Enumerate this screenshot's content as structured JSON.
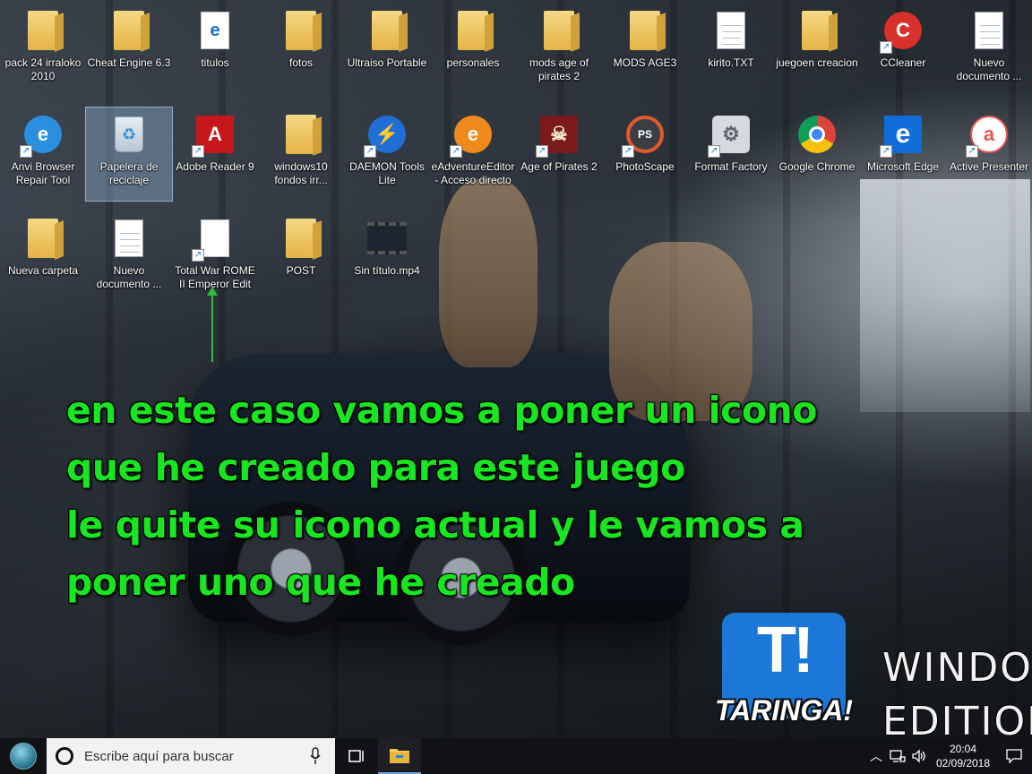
{
  "desktop": {
    "icons": [
      {
        "label": "pack 24  irraloko 2010",
        "icon": "folder-zip-icon"
      },
      {
        "label": "Cheat Engine 6.3",
        "icon": "folder-icon"
      },
      {
        "label": "titulos",
        "icon": "ie-file-icon"
      },
      {
        "label": "fotos",
        "icon": "folder-icon"
      },
      {
        "label": "Ultraiso Portable",
        "icon": "folder-icon"
      },
      {
        "label": "personales",
        "icon": "folder-icon"
      },
      {
        "label": "mods age of pirates 2",
        "icon": "folder-icon"
      },
      {
        "label": "MODS AGE3",
        "icon": "folder-icon"
      },
      {
        "label": "kirito.TXT",
        "icon": "text-file-icon"
      },
      {
        "label": "juegoen creacion",
        "icon": "folder-icon"
      },
      {
        "label": "CCleaner",
        "icon": "ccleaner-icon"
      },
      {
        "label": "Nuevo documento ...",
        "icon": "text-file-icon"
      },
      {
        "label": "Anvi Browser Repair Tool",
        "icon": "internet-explorer-icon"
      },
      {
        "label": "Papelera de reciclaje",
        "icon": "recycle-bin-icon"
      },
      {
        "label": "Adobe Reader 9",
        "icon": "adobe-reader-icon"
      },
      {
        "label": "windows10 fondos irr...",
        "icon": "folder-icon"
      },
      {
        "label": "DAEMON Tools Lite",
        "icon": "daemon-tools-icon"
      },
      {
        "label": "eAdventureEditor - Acceso directo",
        "icon": "eadventure-icon"
      },
      {
        "label": "Age of Pirates 2",
        "icon": "age-of-pirates-icon"
      },
      {
        "label": "PhotoScape",
        "icon": "photoscape-icon"
      },
      {
        "label": "Format Factory",
        "icon": "format-factory-icon"
      },
      {
        "label": "Google Chrome",
        "icon": "chrome-icon"
      },
      {
        "label": "Microsoft Edge",
        "icon": "edge-icon"
      },
      {
        "label": "Active Presenter",
        "icon": "active-presenter-icon"
      },
      {
        "label": "Nueva carpeta",
        "icon": "folder-icon"
      },
      {
        "label": "Nuevo documento ...",
        "icon": "text-file-icon"
      },
      {
        "label": "Total War ROME II Emperor Edit",
        "icon": "blank-file-icon"
      },
      {
        "label": "POST",
        "icon": "folder-icon"
      },
      {
        "label": "Sin título.mp4",
        "icon": "video-file-icon"
      }
    ]
  },
  "caption": {
    "line1": "en este caso vamos a poner un icono",
    "line2": "que he creado para este juego",
    "line3": "le quite su icono actual y le vamos a",
    "line4": "poner uno que he creado"
  },
  "watermark": {
    "taringa_mark": "T!",
    "taringa_word": "TARINGA!",
    "brand_line1": "WINDOWS",
    "brand_line2": "EDITION LI"
  },
  "taskbar": {
    "search_placeholder": "Escribe aquí para buscar",
    "time": "20:04",
    "date": "02/09/2018"
  },
  "colors": {
    "caption": "#18e620",
    "taskbar": "#101216",
    "taringa_blue": "#1b78d8"
  }
}
